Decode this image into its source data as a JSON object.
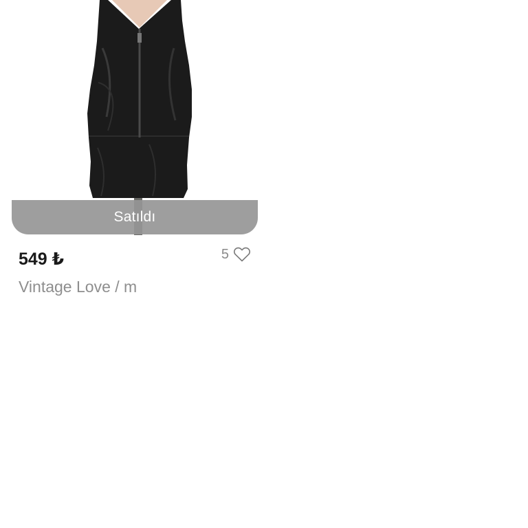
{
  "product": {
    "sold_label": "Satıldı",
    "price": "549 ₺",
    "like_count": "5",
    "brand_size": "Vintage Love / m",
    "image_icon": "leather-dress-photo",
    "like_icon": "heart-outline-icon"
  },
  "colors": {
    "sold_banner": "#969696",
    "price_text": "#1a1a1a",
    "muted_text": "#8e8e8e"
  }
}
